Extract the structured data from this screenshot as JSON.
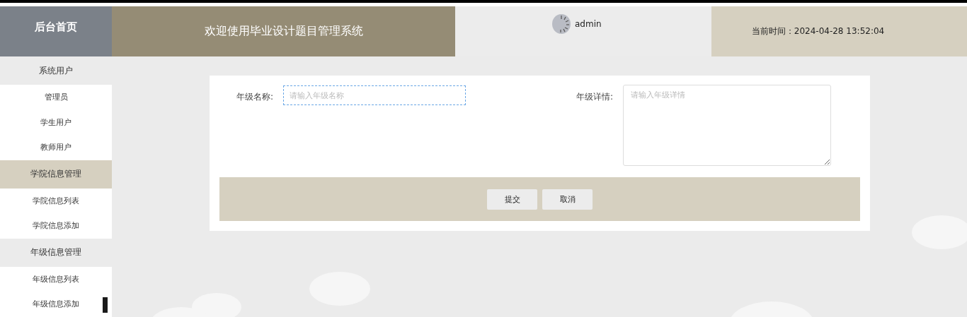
{
  "header": {
    "home_title": "后台首页",
    "system_title": "欢迎使用毕业设计题目管理系统",
    "user": {
      "name": "admin"
    },
    "clock": "当前时间：2024-04-28 13:52:04"
  },
  "sidebar": {
    "groups": [
      {
        "label": "系统用户",
        "selected": false,
        "children": [
          {
            "label": "管理员"
          },
          {
            "label": "学生用户"
          },
          {
            "label": "教师用户"
          }
        ]
      },
      {
        "label": "学院信息管理",
        "selected": true,
        "children": [
          {
            "label": "学院信息列表"
          },
          {
            "label": "学院信息添加"
          }
        ]
      },
      {
        "label": "年级信息管理",
        "selected": false,
        "children": [
          {
            "label": "年级信息列表"
          },
          {
            "label": "年级信息添加"
          }
        ]
      }
    ]
  },
  "form": {
    "fields": [
      {
        "kind": "input",
        "label": "年级名称:",
        "placeholder": "请输入年级名称",
        "focused": true
      },
      {
        "kind": "textarea",
        "label": "年级详情:",
        "placeholder": "请输入年级详情",
        "focused": false
      }
    ],
    "buttons": [
      {
        "label": "提交"
      },
      {
        "label": "取消"
      }
    ]
  }
}
